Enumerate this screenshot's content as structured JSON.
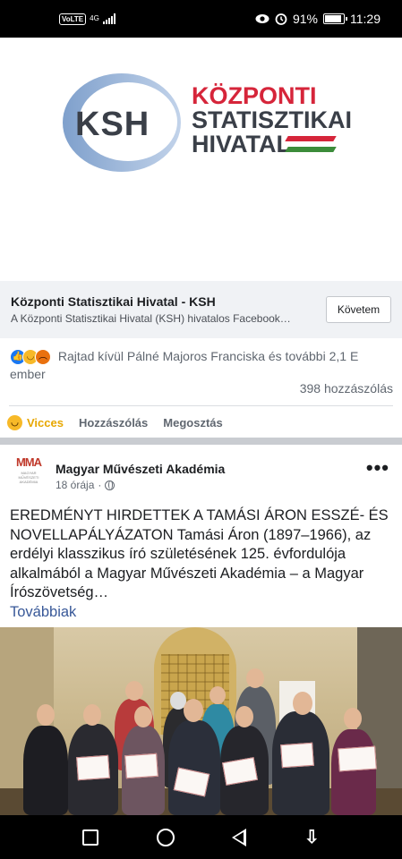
{
  "status_bar": {
    "volte": "VoLTE",
    "network": "4G",
    "battery": "91%",
    "battery_level": 0.91,
    "time": "11:29",
    "icons": [
      "eye-icon",
      "alarm-icon",
      "battery-icon",
      "signal-icon"
    ]
  },
  "shared_link": {
    "logo": {
      "letters": "KSH",
      "line1": "KÖZPONTI",
      "line2": "STATISZTIKAI",
      "line3": "HIVATAL"
    },
    "title": "Központi Statisztikai Hivatal - KSH",
    "description": "A Központi Statisztikai Hivatal (KSH) hivatalos Facebook…",
    "follow_label": "Követem"
  },
  "reactions": {
    "icons": [
      "like-icon",
      "haha-icon",
      "angry-icon"
    ],
    "summary": "Rajtad kívül Pálné Majoros Franciska és további 2,1 E ember",
    "comments": "398 hozzászólás"
  },
  "actions": {
    "reaction_label": "Vicces",
    "comment_label": "Hozzászólás",
    "share_label": "Megosztás"
  },
  "post": {
    "avatar_text": "MMA",
    "avatar_subtext": "MAGYAR MŰVÉSZETI AKADÉMIA",
    "author": "Magyar Művészeti Akadémia",
    "time": "18 órája",
    "separator": "·",
    "text": "EREDMÉNYT HIRDETTEK A TAMÁSI ÁRON ESSZÉ- ÉS NOVELLAPÁLYÁZATON Tamási Áron (1897–1966), az erdélyi klasszikus író születésének 125. évfordulója alkalmából a Magyar Művészeti Akadémia – a Magyar Írószövetség…",
    "see_more": "Továbbiak"
  },
  "colors": {
    "accent_blue": "#1877f2",
    "link_blue": "#385898",
    "haha_yellow": "#f7b928",
    "ksh_red": "#d6253a"
  }
}
